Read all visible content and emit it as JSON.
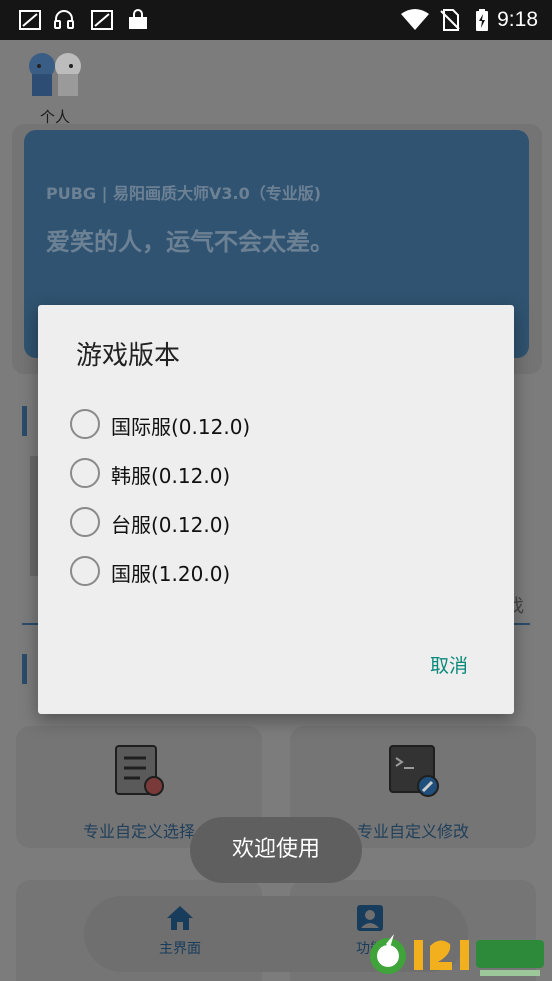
{
  "status_bar": {
    "time": "9:18",
    "icons": [
      "screenshot-icon",
      "headset-icon",
      "screenshot-icon",
      "bag-icon",
      "wifi-icon",
      "no-sim-icon",
      "battery-charging-icon"
    ]
  },
  "profile": {
    "label": "个人"
  },
  "banner": {
    "title": "PUBG | 易阳画质大师V3.0（专业版)",
    "quote": "爱笑的人，运气不会太差。"
  },
  "background": {
    "tab_fragment": "找",
    "tiles": [
      {
        "label": "专业自定义选择",
        "icon": "list-settings-icon"
      },
      {
        "label": "专业自定义修改",
        "icon": "terminal-edit-icon"
      }
    ]
  },
  "bottom_nav": {
    "items": [
      {
        "label": "主界面",
        "icon": "home-icon"
      },
      {
        "label": "功能",
        "icon": "account-box-icon"
      }
    ]
  },
  "toast": {
    "text": "欢迎使用"
  },
  "dialog": {
    "title": "游戏版本",
    "options": [
      {
        "label": "国际服(0.12.0)"
      },
      {
        "label": "韩服(0.12.0)"
      },
      {
        "label": "台服(0.12.0)"
      },
      {
        "label": "国服(1.20.0)"
      }
    ],
    "cancel_label": "取消"
  },
  "watermark": {
    "logo": "121下载站"
  },
  "colors": {
    "banner": "#2f5370",
    "accent": "#2a4c6a",
    "cancel": "#0a8a7a",
    "dialog_bg": "#eeeeee"
  }
}
